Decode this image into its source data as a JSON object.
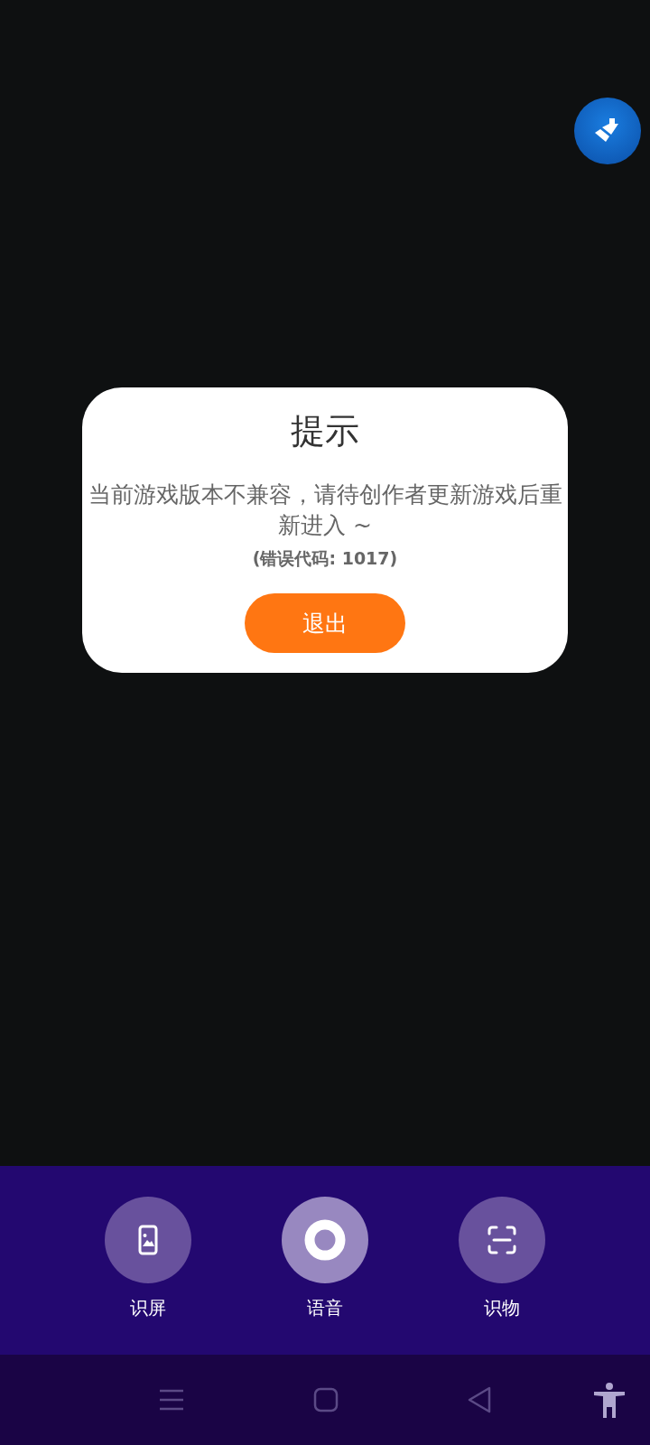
{
  "dialog": {
    "title": "提示",
    "message": "当前游戏版本不兼容，请待创作者更新游戏后重新进入 ~",
    "error_code": "(错误代码: 1017)",
    "button": "退出"
  },
  "tools": [
    {
      "kind": "screen",
      "label": "识屏",
      "selected": false
    },
    {
      "kind": "voice",
      "label": "语音",
      "selected": true
    },
    {
      "kind": "object",
      "label": "识物",
      "selected": false
    }
  ]
}
